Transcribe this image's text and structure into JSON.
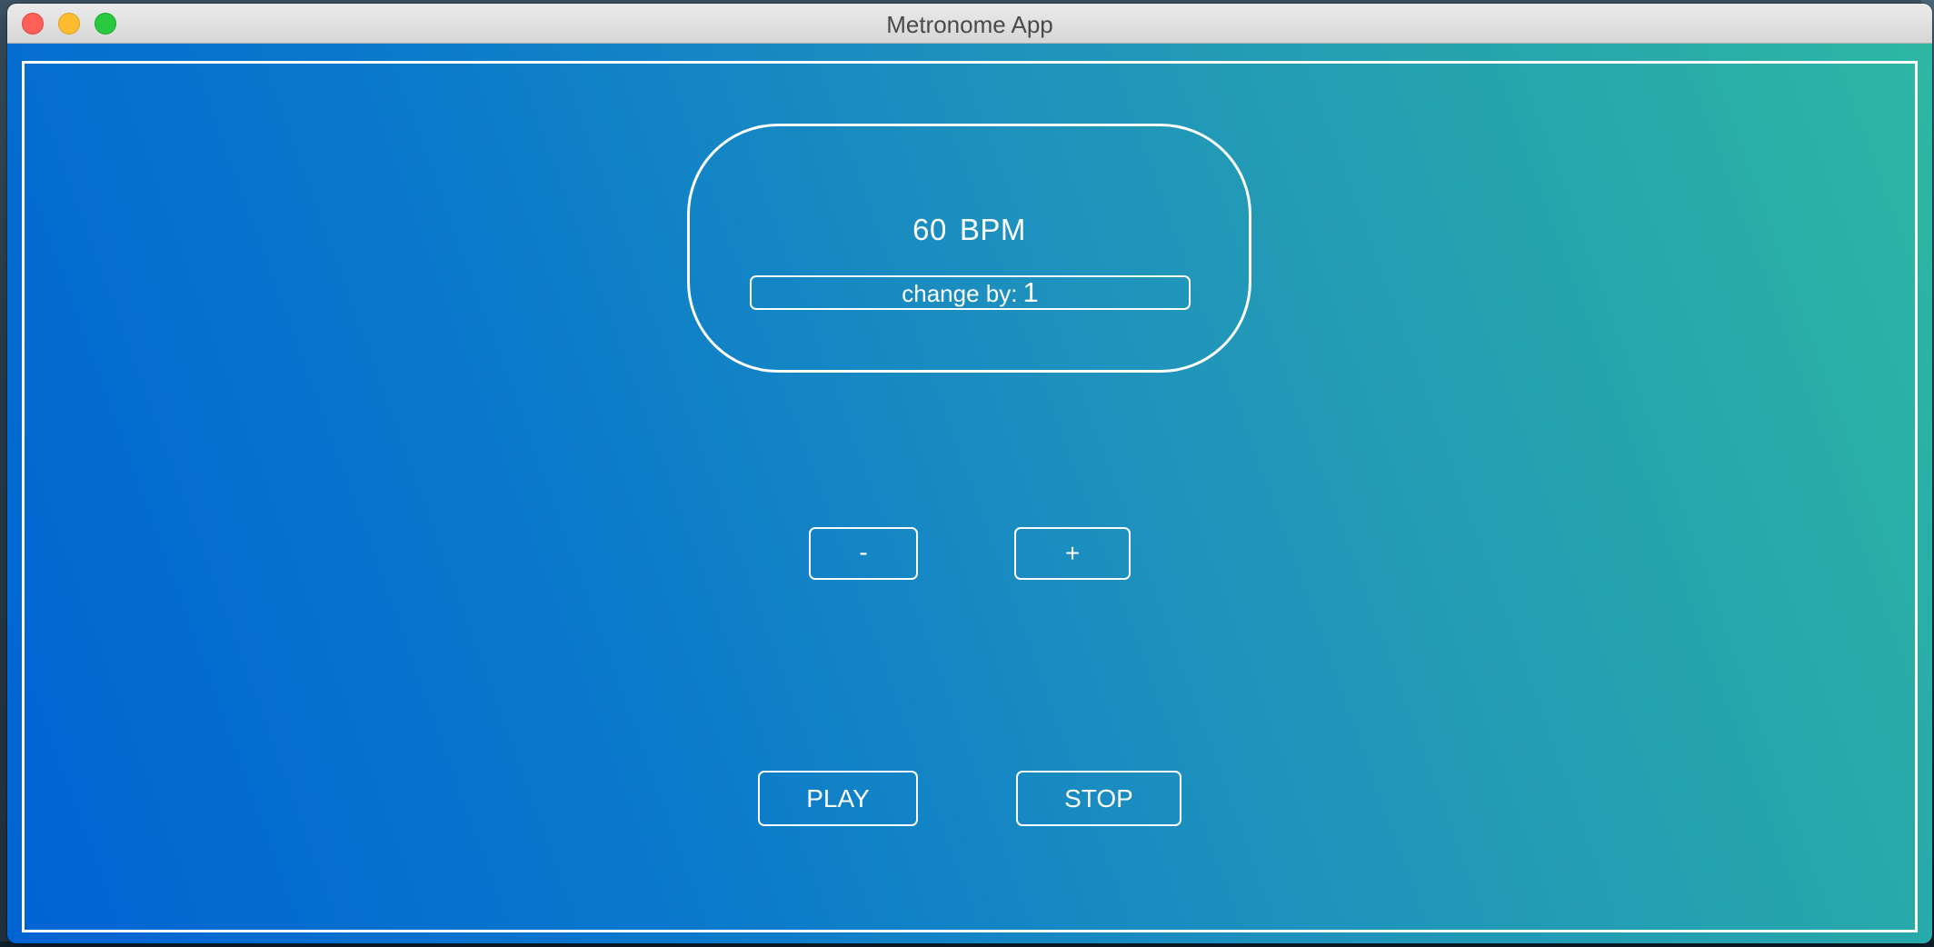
{
  "window": {
    "title": "Metronome App"
  },
  "display": {
    "bpm_value": "60",
    "bpm_unit": "BPM",
    "change_label": "change by:",
    "change_value": "1"
  },
  "controls": {
    "minus_label": "-",
    "plus_label": "+",
    "play_label": "PLAY",
    "stop_label": "STOP"
  },
  "colors": {
    "gradient_start": "#0063d3",
    "gradient_end": "#2db7a3",
    "foreground": "#ffffff",
    "close": "#fe5f57",
    "minimize": "#febc2e",
    "maximize": "#28c840"
  }
}
